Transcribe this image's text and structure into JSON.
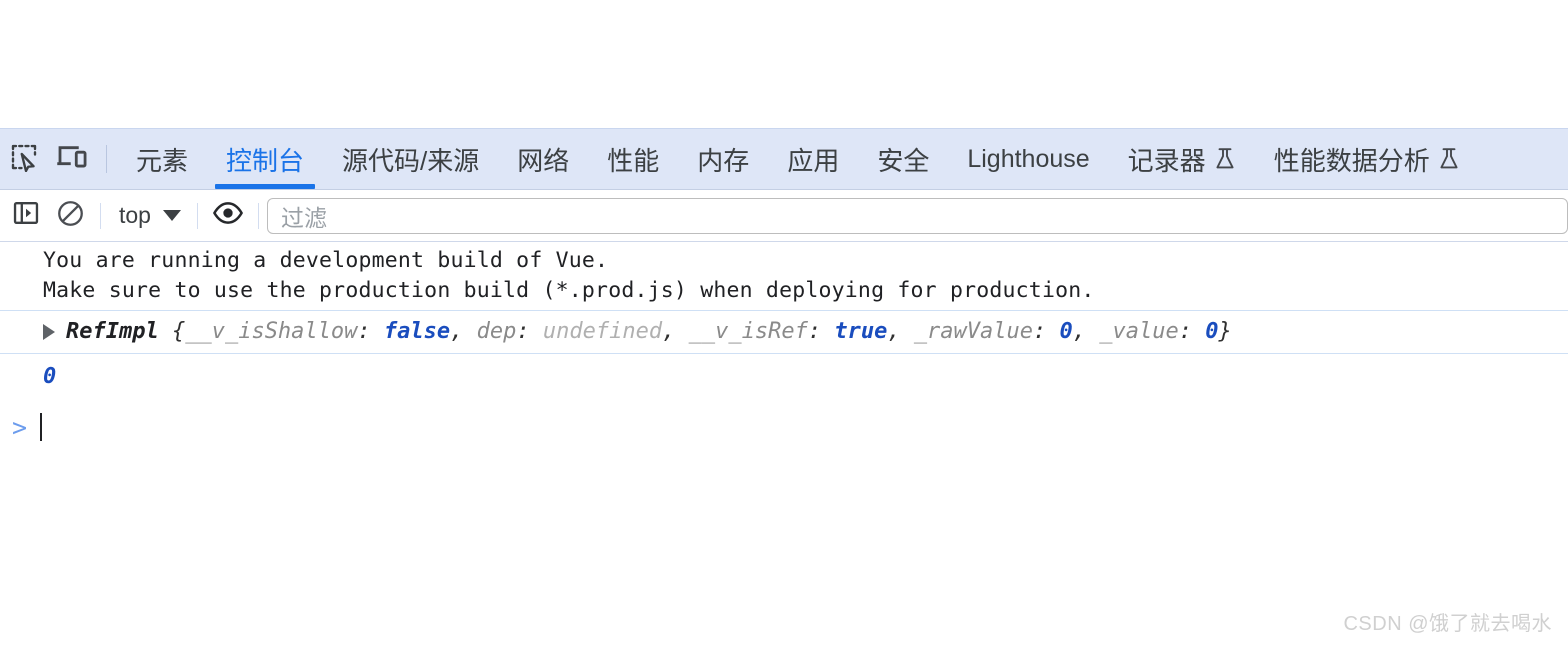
{
  "devtools": {
    "tabbar": {
      "inspect_icon": "inspect-element-icon",
      "device_toolbar_icon": "device-toolbar-icon",
      "tabs": [
        {
          "label": "元素",
          "active": false,
          "flask": false,
          "latin": false
        },
        {
          "label": "控制台",
          "active": true,
          "flask": false,
          "latin": false
        },
        {
          "label": "源代码/来源",
          "active": false,
          "flask": false,
          "latin": false
        },
        {
          "label": "网络",
          "active": false,
          "flask": false,
          "latin": false
        },
        {
          "label": "性能",
          "active": false,
          "flask": false,
          "latin": false
        },
        {
          "label": "内存",
          "active": false,
          "flask": false,
          "latin": false
        },
        {
          "label": "应用",
          "active": false,
          "flask": false,
          "latin": false
        },
        {
          "label": "安全",
          "active": false,
          "flask": false,
          "latin": false
        },
        {
          "label": "Lighthouse",
          "active": false,
          "flask": false,
          "latin": true
        },
        {
          "label": "记录器",
          "active": false,
          "flask": true,
          "latin": false
        },
        {
          "label": "性能数据分析",
          "active": false,
          "flask": true,
          "latin": false
        }
      ]
    },
    "filterbar": {
      "sidebar_toggle_icon": "console-sidebar-icon",
      "clear_console_icon": "clear-console-icon",
      "context": "top",
      "live_expression_icon": "eye-icon",
      "filter_placeholder": "过滤",
      "filter_value": ""
    },
    "console": {
      "messages": [
        {
          "kind": "text",
          "lines": [
            "You are running a development build of Vue.",
            "Make sure to use the production build (*.prod.js) when deploying for production."
          ]
        },
        {
          "kind": "object",
          "constructor": "RefImpl",
          "open_brace": " {",
          "close_brace": "}",
          "properties": [
            {
              "key": "__v_isShallow",
              "sep": ": ",
              "value": "false",
              "type": "boolean",
              "trail": ", "
            },
            {
              "key": "dep",
              "sep": ": ",
              "value": "undefined",
              "type": "undefined",
              "trail": ", "
            },
            {
              "key": "__v_isRef",
              "sep": ": ",
              "value": "true",
              "type": "boolean",
              "trail": ", "
            },
            {
              "key": "_rawValue",
              "sep": ": ",
              "value": "0",
              "type": "number",
              "trail": ", "
            },
            {
              "key": "_value",
              "sep": ": ",
              "value": "0",
              "type": "number",
              "trail": ""
            }
          ]
        },
        {
          "kind": "result",
          "value": "0"
        }
      ],
      "prompt_arrow": ">",
      "prompt_value": ""
    }
  },
  "watermark": "CSDN @饿了就去喝水",
  "colors": {
    "tabbar_bg": "#dee6f7",
    "accent": "#1a73e8",
    "value_blue": "#1a4dbe",
    "muted": "#8a8a8a",
    "separator": "#cfe0f5"
  }
}
